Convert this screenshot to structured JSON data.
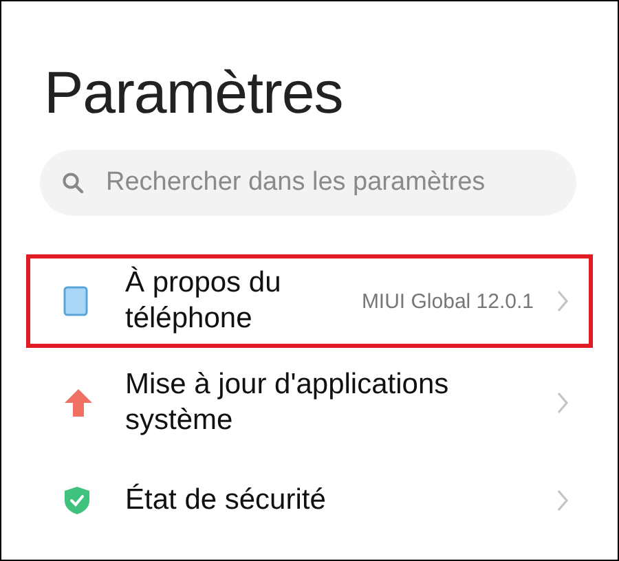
{
  "title": "Paramètres",
  "search": {
    "placeholder": "Rechercher dans les paramètres"
  },
  "items": [
    {
      "kind": "phone",
      "label": "À propos du téléphone",
      "value": "MIUI Global 12.0.1",
      "highlighted": true
    },
    {
      "kind": "update",
      "label": "Mise à jour d'applications système",
      "highlighted": false
    },
    {
      "kind": "security",
      "label": "État de sécurité",
      "highlighted": false
    }
  ]
}
